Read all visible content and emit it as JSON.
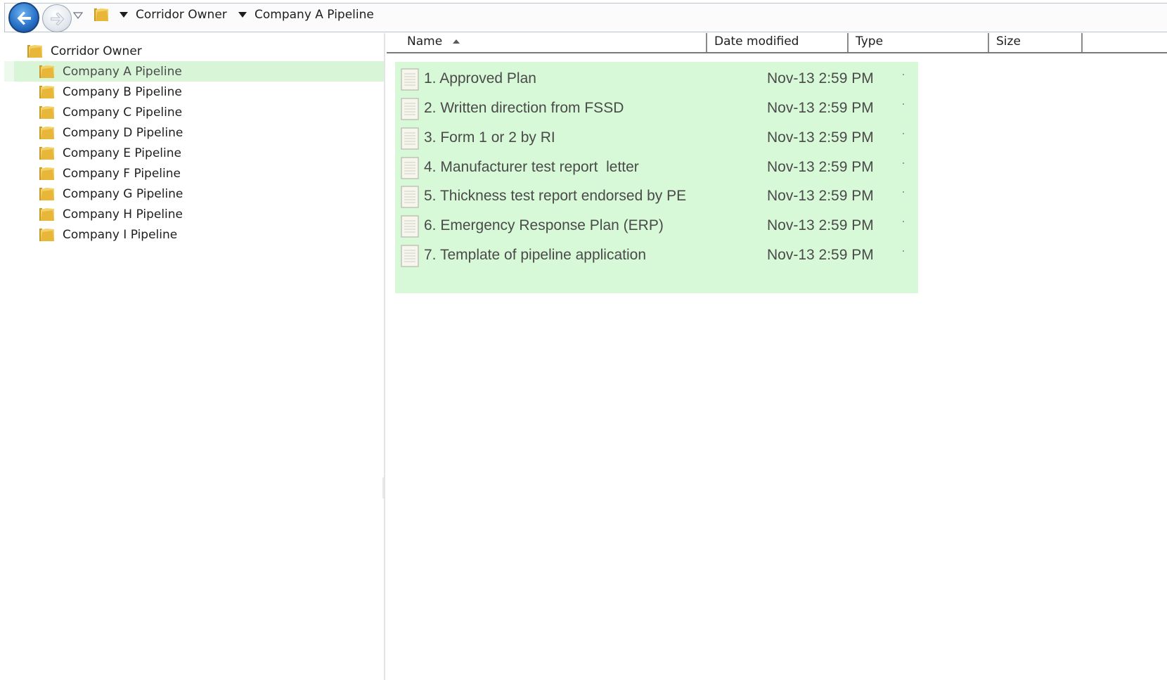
{
  "address_bar": {
    "breadcrumbs": [
      "Corridor Owner",
      "Company A Pipeline"
    ]
  },
  "nav_pane": {
    "root": "Corridor Owner",
    "children": [
      {
        "label": "Company A Pipeline",
        "selected": true
      },
      {
        "label": "Company B Pipeline",
        "selected": false
      },
      {
        "label": "Company C Pipeline",
        "selected": false
      },
      {
        "label": "Company D Pipeline",
        "selected": false
      },
      {
        "label": "Company E Pipeline",
        "selected": false
      },
      {
        "label": "Company F Pipeline",
        "selected": false
      },
      {
        "label": "Company G Pipeline",
        "selected": false
      },
      {
        "label": "Company H Pipeline",
        "selected": false
      },
      {
        "label": "Company I Pipeline",
        "selected": false
      }
    ]
  },
  "file_list": {
    "columns": [
      "Name",
      "Date modified",
      "Type",
      "Size"
    ],
    "sort_column": "Name",
    "sort_direction": "ascending",
    "files": [
      {
        "name": "1. Approved Plan",
        "date": "Nov-13 2:59 PM"
      },
      {
        "name": "2. Written direction from FSSD",
        "date": "Nov-13 2:59 PM"
      },
      {
        "name": "3. Form 1 or 2 by RI",
        "date": "Nov-13 2:59 PM"
      },
      {
        "name": "4. Manufacturer test report  letter",
        "date": "Nov-13 2:59 PM"
      },
      {
        "name": "5. Thickness test report endorsed by PE",
        "date": "Nov-13 2:59 PM"
      },
      {
        "name": "6. Emergency Response Plan (ERP)",
        "date": "Nov-13 2:59 PM"
      },
      {
        "name": "7. Template of pipeline application",
        "date": "Nov-13 2:59 PM"
      }
    ]
  },
  "colors": {
    "selection_green": "#d8f9d8",
    "text_dim": "#4a4a4a",
    "folder_yellow": "#e8c04a"
  },
  "icons": {
    "back": "back-arrow-icon",
    "forward": "forward-arrow-icon",
    "folder": "folder-icon",
    "document": "text-document-icon"
  }
}
